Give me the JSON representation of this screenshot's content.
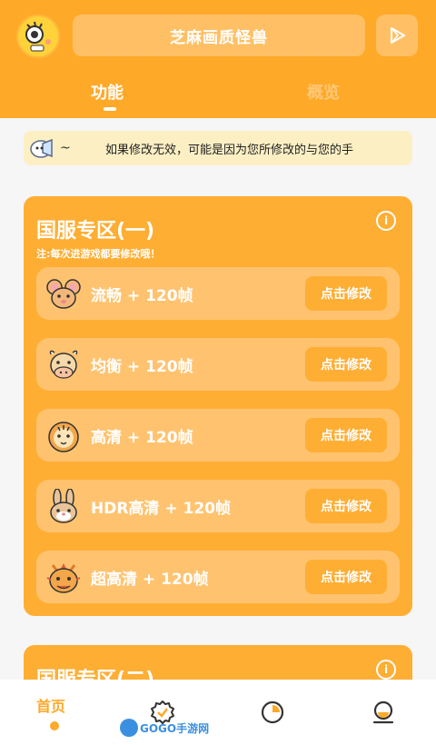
{
  "header": {
    "title": "芝麻画质怪兽",
    "avatar_icon": "smiley-mascot-icon",
    "play_icon": "play-icon",
    "accent_color": "#FFA928"
  },
  "tabs": [
    {
      "label": "功能",
      "active": true
    },
    {
      "label": "概览",
      "active": false
    }
  ],
  "notice": {
    "tilde": "~",
    "text": "如果修改无效，可能是因为您所修改的与您的手"
  },
  "panel1": {
    "title": "国服专区(一)",
    "note": "注:每次进游戏都要修改哦！",
    "items": [
      {
        "label": "流畅 + 120帧",
        "button": "点击修改",
        "icon": "mouse-icon"
      },
      {
        "label": "均衡 + 120帧",
        "button": "点击修改",
        "icon": "cow-icon"
      },
      {
        "label": "高清 + 120帧",
        "button": "点击修改",
        "icon": "tiger-icon"
      },
      {
        "label": "HDR高清 + 120帧",
        "button": "点击修改",
        "icon": "rabbit-icon"
      },
      {
        "label": "超高清 + 120帧",
        "button": "点击修改",
        "icon": "dragon-icon"
      }
    ]
  },
  "panel2": {
    "title": "国服专区(二)"
  },
  "bottom_nav": {
    "home": "首页",
    "watermark": "GOGO手游网"
  }
}
